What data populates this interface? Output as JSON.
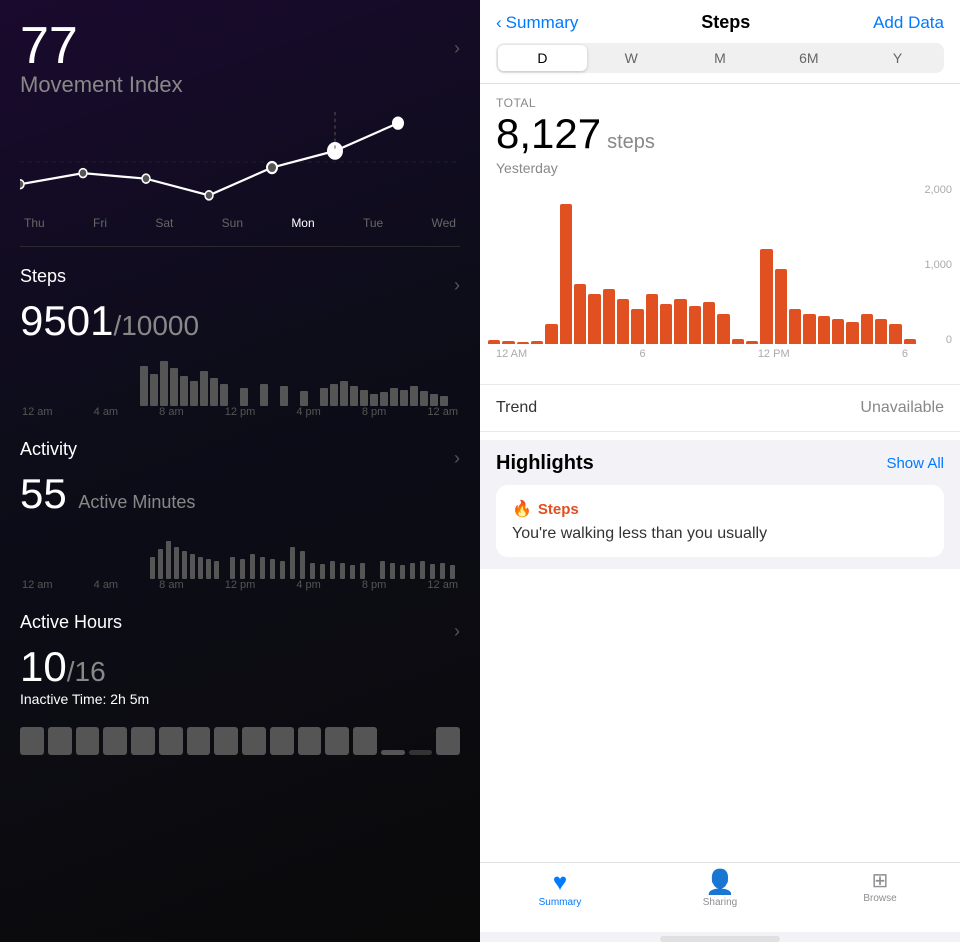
{
  "left": {
    "movement_value": "77",
    "movement_label": "Movement Index",
    "day_labels": [
      "Thu",
      "Fri",
      "Sat",
      "Sun",
      "Mon",
      "Tue",
      "Wed"
    ],
    "active_day": "Tue",
    "steps_title": "Steps",
    "steps_value": "9501",
    "steps_goal": "/10000",
    "steps_time_labels": [
      "12 am",
      "4 am",
      "8 am",
      "12 pm",
      "4 pm",
      "8 pm",
      "12 am"
    ],
    "activity_title": "Activity",
    "activity_value": "55",
    "activity_unit": "Active Minutes",
    "activity_time_labels": [
      "12 am",
      "4 am",
      "8 am",
      "12 pm",
      "4 pm",
      "8 pm",
      "12 am"
    ],
    "active_hours_title": "Active Hours",
    "active_hours_value": "10",
    "active_hours_goal": "/16",
    "inactive_time_label": "Inactive Time:",
    "inactive_time_value": "2h 5m"
  },
  "right": {
    "back_label": "Summary",
    "page_title": "Steps",
    "add_data_label": "Add Data",
    "period_tabs": [
      "D",
      "W",
      "M",
      "6M",
      "Y"
    ],
    "active_tab": "D",
    "total_label": "TOTAL",
    "steps_count": "8,127",
    "steps_unit": "steps",
    "steps_date": "Yesterday",
    "chart_y_labels": [
      "2,000",
      "1,000",
      "0"
    ],
    "chart_x_labels": [
      "12 AM",
      "6",
      "12 PM",
      "6"
    ],
    "trend_label": "Trend",
    "trend_value": "Unavailable",
    "highlights_title": "Highlights",
    "show_all_label": "Show All",
    "highlight_icon": "🔥",
    "highlight_title": "Steps",
    "highlight_text": "You're walking less than you usually",
    "tabs": [
      {
        "label": "Summary",
        "icon": "♥",
        "active": true
      },
      {
        "label": "Sharing",
        "icon": "👤",
        "active": false
      },
      {
        "label": "Browse",
        "icon": "⊞",
        "active": false
      }
    ]
  }
}
